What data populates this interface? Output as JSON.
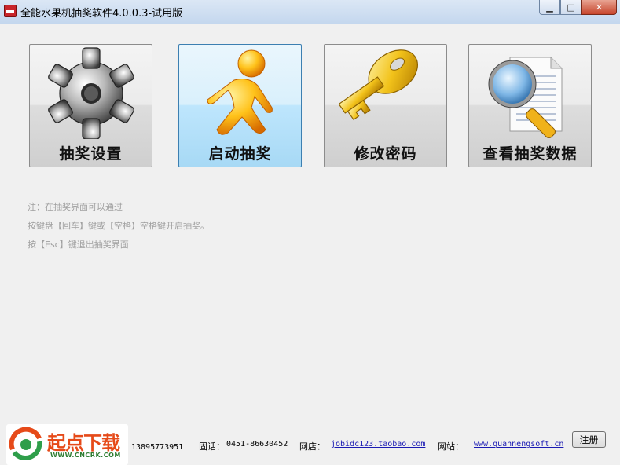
{
  "window": {
    "title": "全能水果机抽奖软件4.0.0.3-试用版",
    "min_symbol": "▁",
    "max_symbol": "□",
    "close_symbol": "✕"
  },
  "buttons": [
    {
      "label": "抽奖设置",
      "icon": "gear-icon"
    },
    {
      "label": "启动抽奖",
      "icon": "running-person-icon"
    },
    {
      "label": "修改密码",
      "icon": "key-icon"
    },
    {
      "label": "查看抽奖数据",
      "icon": "magnifier-document-icon"
    }
  ],
  "notes": [
    "注：在抽奖界面可以通过",
    "按键盘【回车】键或【空格】空格键开启抽奖。",
    "按【Esc】键退出抽奖界面"
  ],
  "footer": {
    "phone_fragment": "：13895773951",
    "tel_label": "固话：",
    "tel_value": "0451-86630452",
    "shop_label": "网店：",
    "shop_link": "jobidc123.taobao.com",
    "site_label": "网站：",
    "site_link": "www.quannengsoft.cn",
    "register_label": "注册"
  },
  "watermark": {
    "name": "起点下载",
    "url": "WWW.CNCRK.COM"
  },
  "colors": {
    "titlebar": "#c4d7ee",
    "client_bg": "#f0f0f0",
    "active_button": "#bee6fd",
    "note_text": "#a0a0a0",
    "link": "#1a1ab3"
  }
}
